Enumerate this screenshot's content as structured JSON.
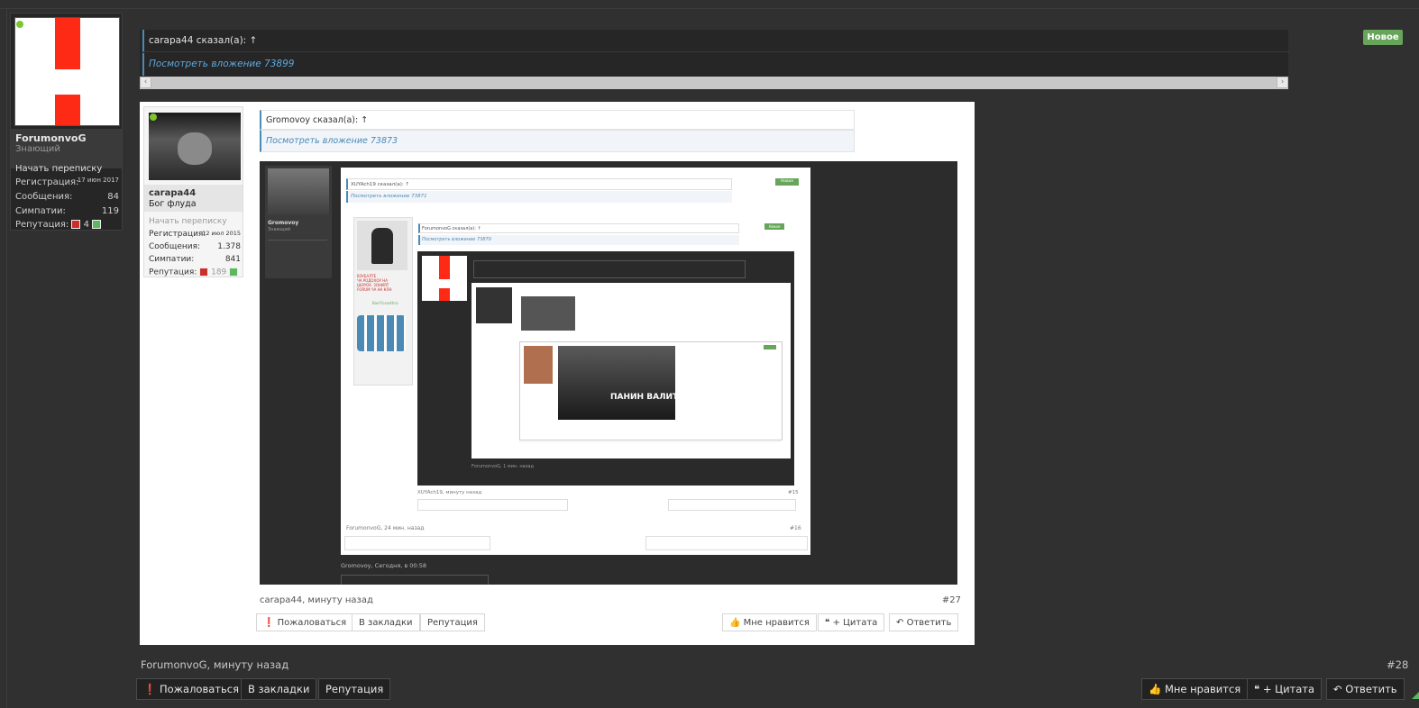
{
  "badge_new": "Новое",
  "main_user": {
    "name": "ForumonvoG",
    "title": "Знающий",
    "start_conversation": "Начать переписку",
    "stats": [
      {
        "label": "Регистрация:",
        "value": "17 июн 2017"
      },
      {
        "label": "Сообщения:",
        "value": "84"
      },
      {
        "label": "Симпатии:",
        "value": "119"
      }
    ],
    "reputation_label": "Репутация:",
    "reputation_value": "4"
  },
  "quote": {
    "header": "carapa44 сказал(а): ↑",
    "attachment_link": "Посмотреть вложение 73899"
  },
  "embedded": {
    "user": {
      "name": "carapa44",
      "title": "Бог флуда",
      "start_conversation": "Начать переписку",
      "stats": [
        {
          "label": "Регистрация:",
          "value": "12 июл 2015"
        },
        {
          "label": "Сообщения:",
          "value": "1.378"
        },
        {
          "label": "Симпатии:",
          "value": "841"
        }
      ],
      "reputation_label": "Репутация:",
      "reputation_value": "189"
    },
    "quote_header": "Gromovoy сказал(а): ↑",
    "quote_link": "Посмотреть вложение 73873",
    "nested": {
      "quote_header_1": "XUYAch19 сказал(а): ↑",
      "quote_link_1": "Посмотреть вложение 73871",
      "badge_1": "Новое",
      "user1_name": "Gromovoy",
      "user1_title": "Знающий",
      "quote_header_2": "ForumonvoG сказал(а): ↑",
      "quote_link_2": "Посмотреть вложение 73870",
      "badge_2": "Новое",
      "user2_lines": [
        "ВЗУБАЛТЕ",
        "ЧА РОДОХОУ НА",
        "ШОРОХ. ЗОНИЯТ",
        "FORUM ЧА НА КЛН"
      ],
      "user2_name": "Bad Foranthra",
      "video_text": "ПАНИН ВАЛИТ!",
      "meta_1": "ForumonvoG, 24 мин. назад",
      "num_1": "#16",
      "meta_2": "XUYAch19, минуту назад",
      "num_2": "#15",
      "meta_3": "ForumonvoG, 1 мин. назад",
      "meta_outer": "Gromovoy, Сегодня, в 00:58"
    },
    "meta": "carapa44, минуту назад",
    "post_number": "#27",
    "buttons": {
      "report": "Пожаловаться",
      "bookmark": "В закладки",
      "reputation": "Репутация",
      "like": "Мне нравится",
      "quote": "+ Цитата",
      "reply": "Ответить"
    }
  },
  "post": {
    "meta": "ForumonvoG, минуту назад",
    "number": "#28",
    "buttons": {
      "report": "Пожаловаться",
      "bookmark": "В закладки",
      "reputation": "Репутация",
      "like": "Мне нравится",
      "quote": "+ Цитата",
      "reply": "Ответить"
    }
  },
  "colors": {
    "background": "#303030",
    "accent_blue": "#4a8ab5",
    "new_badge": "#66a55a",
    "avatar_red": "#ff2a16"
  }
}
